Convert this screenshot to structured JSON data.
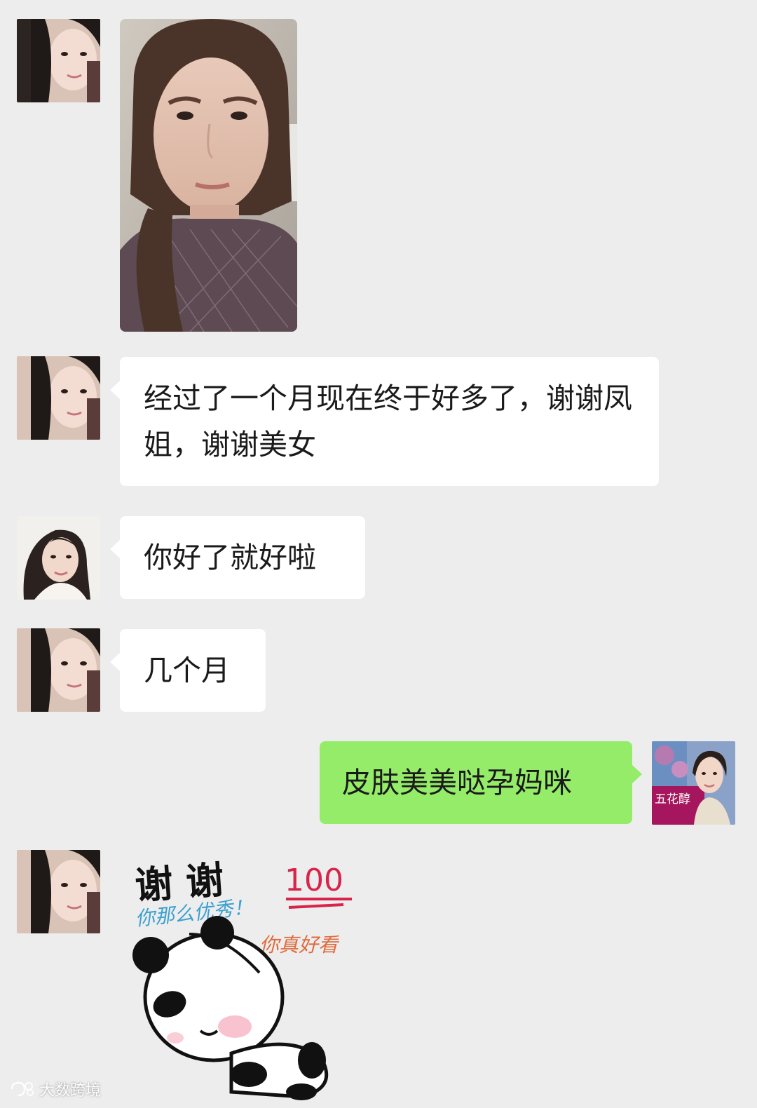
{
  "messages": [
    {
      "id": "m1",
      "side": "left",
      "type": "image",
      "sender": "contact-a",
      "image": "selfie-photo"
    },
    {
      "id": "m2",
      "side": "left",
      "type": "text",
      "sender": "contact-a",
      "text": "经过了一个月现在终于好多了，谢谢凤姐，谢谢美女"
    },
    {
      "id": "m3",
      "side": "left",
      "type": "text",
      "sender": "contact-b",
      "text": "你好了就好啦"
    },
    {
      "id": "m4",
      "side": "left",
      "type": "text",
      "sender": "contact-a",
      "text": "几个月"
    },
    {
      "id": "m5",
      "side": "right",
      "type": "text",
      "sender": "me",
      "text": "皮肤美美哒孕妈咪"
    },
    {
      "id": "m6",
      "side": "left",
      "type": "sticker",
      "sender": "contact-a",
      "sticker": {
        "line1": "谢 谢",
        "badge": "100",
        "line2": "你那么优秀！",
        "line3": "你真好看"
      }
    }
  ],
  "avatars": {
    "me_sign_text": "五花醇"
  },
  "watermark": {
    "text": "大数跨境"
  },
  "colors": {
    "background": "#ededed",
    "incoming_bubble": "#ffffff",
    "outgoing_bubble": "#95ec69",
    "text": "#1a1a1a"
  }
}
